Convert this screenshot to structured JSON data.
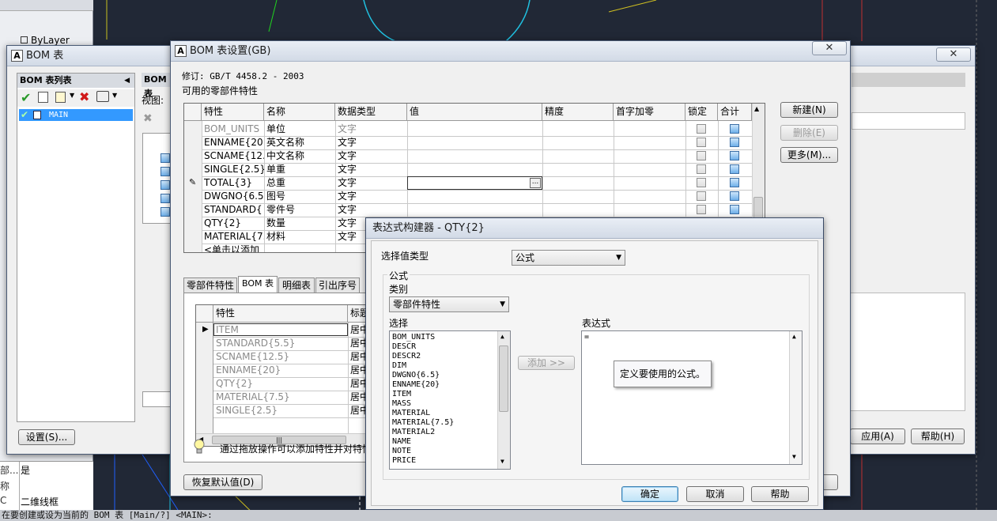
{
  "status_bar": "在要创建或设为当前的 BOM 表 [Main/?] <MAIN>:",
  "palette": {
    "bylayer": "ByLayer",
    "rows": [
      {
        "k": "部...",
        "v": "是"
      },
      {
        "k": "称",
        "v": ""
      },
      {
        "k": "C",
        "v": "二维线框"
      }
    ]
  },
  "bom_list_window": {
    "title": "BOM 表",
    "panel_title": "BOM 表列表",
    "panel2_title": "BOM 表",
    "view_label": "视图:",
    "items": [
      "MAIN"
    ],
    "settings_button": "设置(S)...",
    "apply_button": "应用(A)",
    "help_button": "帮助(H)"
  },
  "bom_settings": {
    "title": "BOM 表设置(GB)",
    "revision": "修订: GB/T 4458.2 - 2003",
    "section_label": "可用的零部件特性",
    "columns": [
      "特性",
      "名称",
      "数据类型",
      "值",
      "精度",
      "首字加零",
      "锁定",
      "合计"
    ],
    "rows": [
      {
        "prop": "BOM_UNITS",
        "name": "单位",
        "type": "文字",
        "dim": true
      },
      {
        "prop": "ENNAME{20",
        "name": "英文名称",
        "type": "文字"
      },
      {
        "prop": "SCNAME{12.",
        "name": "中文名称",
        "type": "文字"
      },
      {
        "prop": "SINGLE{2.5}",
        "name": "单重",
        "type": "文字"
      },
      {
        "prop": "TOTAL{3}",
        "name": "总重",
        "type": "文字",
        "editing": true
      },
      {
        "prop": "DWGNO{6.5",
        "name": "图号",
        "type": "文字"
      },
      {
        "prop": "STANDARD{",
        "name": "零件号",
        "type": "文字"
      },
      {
        "prop": "QTY{2}",
        "name": "数量",
        "type": "文字"
      },
      {
        "prop": "MATERIAL{7.",
        "name": "材料",
        "type": "文字"
      }
    ],
    "add_row": "<单击以添加",
    "buttons": {
      "new": "新建(N)",
      "delete": "删除(E)",
      "more": "更多(M)...",
      "restore": "恢复默认值(D)"
    },
    "tabs": [
      "零部件特性",
      "BOM 表",
      "明细表",
      "引出序号"
    ],
    "bom_columns": [
      "特性",
      "标题"
    ],
    "bom_rows": [
      {
        "prop": "ITEM",
        "align": "居中"
      },
      {
        "prop": "STANDARD{5.5}",
        "align": "居中"
      },
      {
        "prop": "SCNAME{12.5}",
        "align": "居中"
      },
      {
        "prop": "ENNAME{20}",
        "align": "居中"
      },
      {
        "prop": "QTY{2}",
        "align": "居中"
      },
      {
        "prop": "MATERIAL{7.5}",
        "align": "居中"
      },
      {
        "prop": "SINGLE{2.5}",
        "align": "居中"
      }
    ],
    "hint": "通过拖放操作可以添加特性并对特性"
  },
  "expr_builder": {
    "title": "表达式构建器 - QTY{2}",
    "value_type_label": "选择值类型",
    "value_type": "公式",
    "formula_group": "公式",
    "category_label": "类别",
    "category": "零部件特性",
    "select_label": "选择",
    "options": [
      "BOM_UNITS",
      "DESCR",
      "DESCR2",
      "DIM",
      "DWGNO{6.5}",
      "ENNAME{20}",
      "ITEM",
      "MASS",
      "MATERIAL",
      "MATERIAL{7.5}",
      "MATERIAL2",
      "NAME",
      "NOTE",
      "PRICE"
    ],
    "add_button": "添加 >>",
    "expression_label": "表达式",
    "expression_value": "=",
    "tooltip": "定义要使用的公式。",
    "ok": "确定",
    "cancel": "取消",
    "help": "帮助"
  },
  "colors": {
    "accent": "#3c7fb1",
    "title_bg": "#d2dae6",
    "cad_bg": "#212836"
  }
}
